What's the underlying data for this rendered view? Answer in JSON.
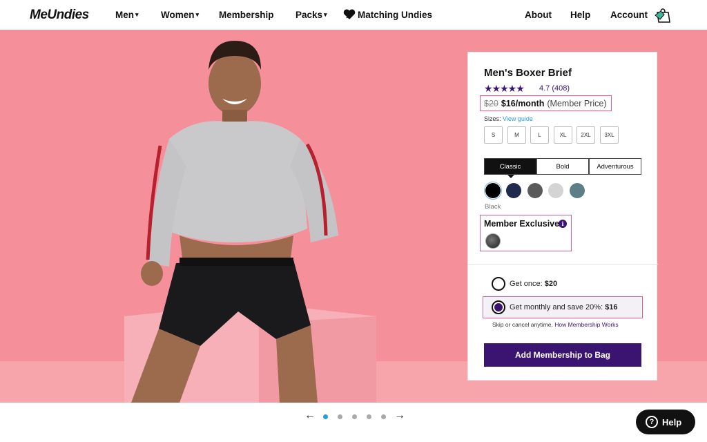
{
  "nav": {
    "logo": "MeUndies",
    "items": [
      {
        "label": "Men",
        "caret": true
      },
      {
        "label": "Women",
        "caret": true
      },
      {
        "label": "Membership",
        "caret": false
      },
      {
        "label": "Packs",
        "caret": true
      },
      {
        "label": "Matching Undies",
        "caret": false
      }
    ],
    "right": [
      "About",
      "Help",
      "Account"
    ],
    "icons": {
      "heart": "heart-icon",
      "bag": "shopping-bag-icon"
    }
  },
  "product": {
    "title": "Men's Boxer Brief",
    "stars": "★★★★★",
    "rating": "4.7",
    "reviews": "(408)",
    "old_price": "$20",
    "price": "$16/month",
    "price_note": "(Member Price)",
    "sizes_label": "Sizes:",
    "size_guide": "View guide",
    "sizes": [
      "S",
      "M",
      "L",
      "XL",
      "2XL",
      "3XL"
    ],
    "styles": [
      "Classic",
      "Bold",
      "Adventurous"
    ],
    "selected_style": "Classic",
    "colors": [
      "#000000",
      "#1f2a4f",
      "#5a5a5a",
      "#d4d4d4",
      "#5b7e87"
    ],
    "selected_color": "Black",
    "exclusive_label": "Member Exclusive",
    "info_symbol": "i",
    "purchase": {
      "once_text": "Get once: ",
      "once_price": "$20",
      "monthly_text": "Get monthly and save 20%: ",
      "monthly_price": "$16",
      "skip_text": "Skip or cancel anytime. ",
      "skip_link": "How Membership Works"
    },
    "cta": "Add Membership to Bag"
  },
  "carousel": {
    "prev": "←",
    "next": "→",
    "slides": 5,
    "active": 0
  },
  "help": {
    "label": "Help",
    "symbol": "?"
  },
  "colors": {
    "hero_bg": "#f5909a",
    "brand_purple": "#3a1470",
    "highlight": "#e8588e",
    "link_blue": "#2a9fd6"
  }
}
